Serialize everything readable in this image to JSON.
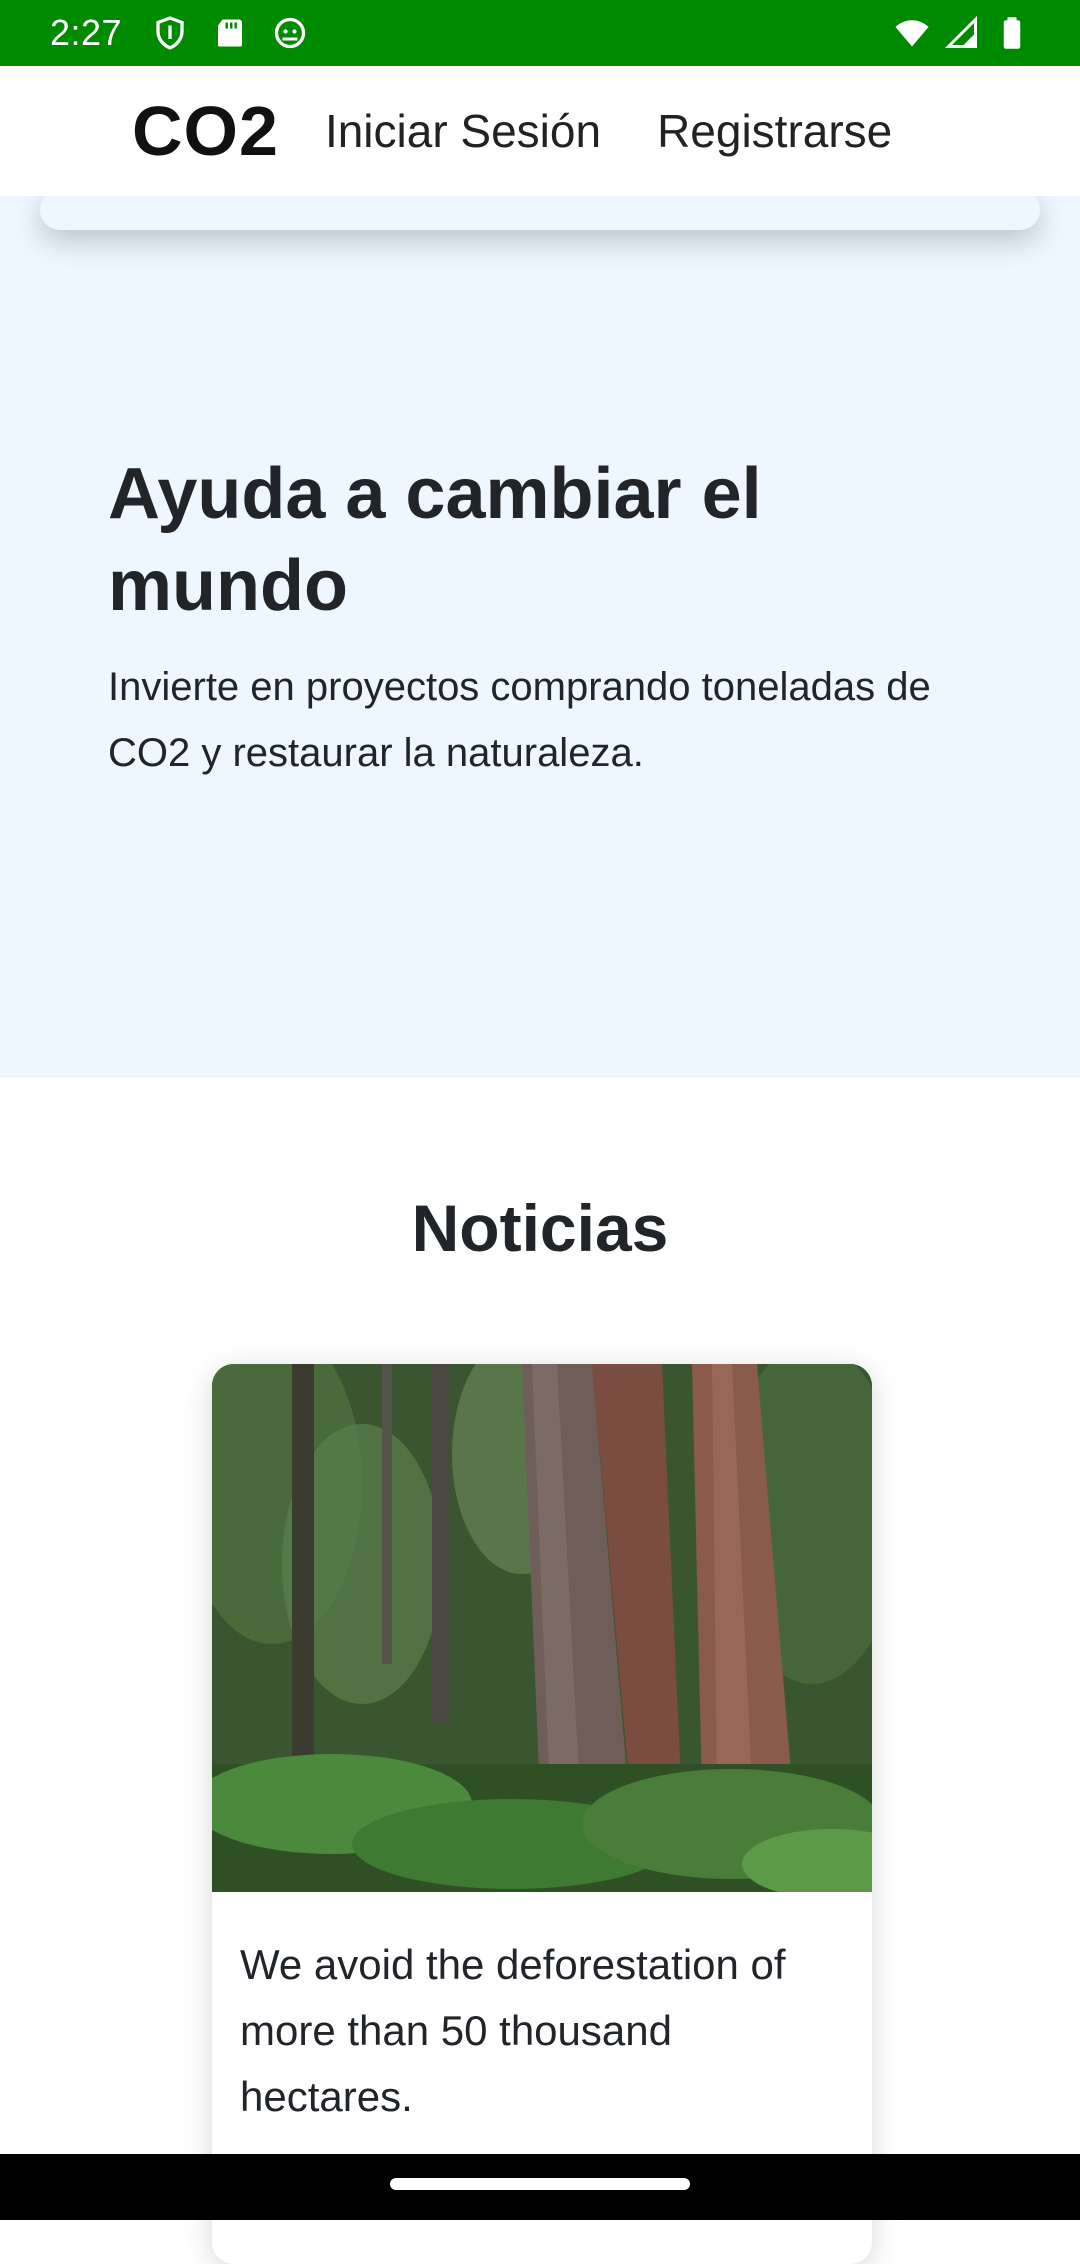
{
  "status_bar": {
    "time": "2:27",
    "left_icons": [
      "shield-icon",
      "sd-card-icon",
      "android-icon"
    ],
    "right_icons": [
      "wifi-icon",
      "signal-icon",
      "battery-icon"
    ],
    "color": "#008a00"
  },
  "navbar": {
    "brand": "CO2",
    "links": [
      "Iniciar Sesión",
      "Registrarse"
    ]
  },
  "hero": {
    "title": "Ayuda a cambiar el mundo",
    "text": "Invierte en proyectos comprando toneladas de CO2 y restaurar la naturaleza.",
    "background": "#eef6ff"
  },
  "news": {
    "title": "Noticias",
    "cards": [
      {
        "image_icon": "forest-image",
        "text": "We avoid the deforestation of more than 50 thousand hectares."
      }
    ]
  }
}
